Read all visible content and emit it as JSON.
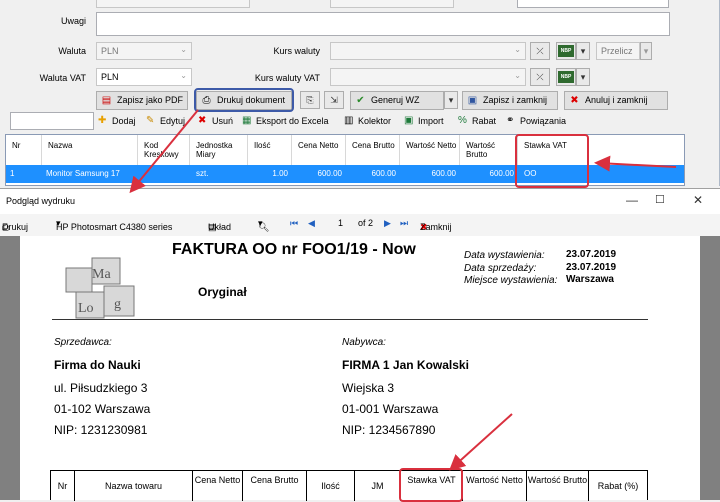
{
  "form": {
    "uwagi_label": "Uwagi",
    "waluta_label": "Waluta",
    "waluta_value": "PLN",
    "waluta_vat_label": "Waluta VAT",
    "waluta_vat_value": "PLN",
    "kurs_waluty_label": "Kurs waluty",
    "kurs_waluty_vat_label": "Kurs waluty VAT",
    "przelicz_label": "Przelicz",
    "nbp_label": "NBP"
  },
  "buttons": {
    "pdf": "Zapisz jako PDF",
    "print": "Drukuj dokument",
    "wz": "Generuj WZ",
    "save_close": "Zapisz i zamknij",
    "cancel_close": "Anuluj i zamknij"
  },
  "toolbar": {
    "add": "Dodaj",
    "edit": "Edytuj",
    "delete": "Usuń",
    "export": "Eksport do Excela",
    "collector": "Kolektor",
    "import": "Import",
    "discount": "Rabat",
    "links": "Powiązania"
  },
  "grid": {
    "headers": [
      "Nr",
      "Nazwa",
      "Kod Kreskowy",
      "Jednostka Miary",
      "Ilość",
      "Cena Netto",
      "Cena Brutto",
      "Wartość Netto",
      "Wartość Brutto",
      "Stawka VAT"
    ],
    "row": [
      "1",
      "Monitor Samsung 17",
      "",
      "szt.",
      "1.00",
      "600.00",
      "600.00",
      "600.00",
      "600.00",
      "OO"
    ]
  },
  "preview": {
    "title": "Podgląd wydruku",
    "print": "Drukuj",
    "printer": "HP Photosmart C4380 series",
    "layout": "Układ",
    "page_current": "1",
    "page_total": "of 2",
    "close": "Zamknij"
  },
  "invoice": {
    "title": "FAKTURA OO nr FOO1/19 - Now",
    "original": "Oryginał",
    "issue_date_label": "Data wystawienia:",
    "issue_date": "23.07.2019",
    "sale_date_label": "Data sprzedaży:",
    "sale_date": "23.07.2019",
    "place_label": "Miejsce wystawienia:",
    "place": "Warszawa",
    "seller_label": "Sprzedawca:",
    "seller_name": "Firma do Nauki",
    "seller_street": "ul. Piłsudzkiego 3",
    "seller_city": "01-102  Warszawa",
    "seller_nip": "NIP: 1231230981",
    "buyer_label": "Nabywca:",
    "buyer_name": "FIRMA 1 Jan Kowalski",
    "buyer_street": "Wiejska 3",
    "buyer_city": "01-001  Warszawa",
    "buyer_nip": "NIP: 1234567890",
    "table_headers": [
      "Nr",
      "Nazwa towaru",
      "Cena Netto",
      "Cena Brutto",
      "Ilość",
      "JM",
      "Stawka VAT",
      "Wartość Netto",
      "Wartość Brutto",
      "Rabat (%)"
    ]
  },
  "colors": {
    "selection": "#1e90ff",
    "highlight": "#d9303e",
    "arrow": "#d9303e"
  }
}
